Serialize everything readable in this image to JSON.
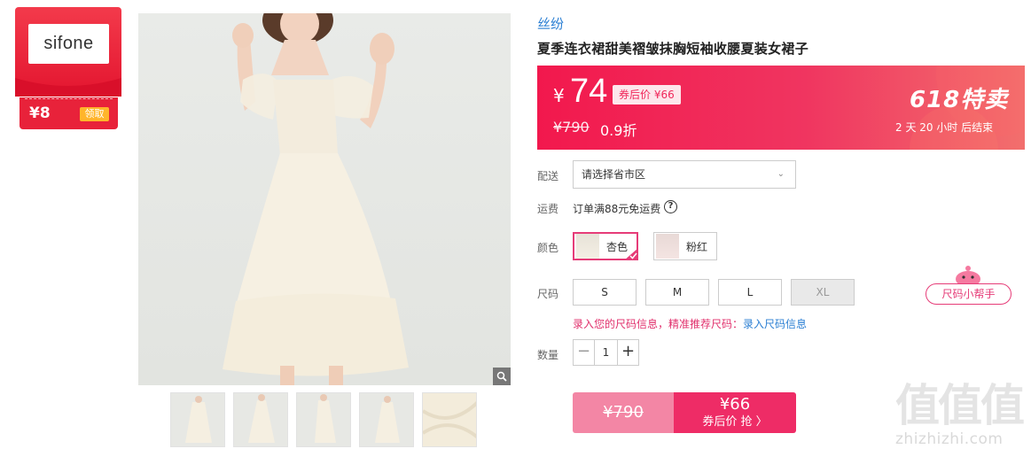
{
  "store": {
    "logo_text": "sifone",
    "coupon_amount": "¥8",
    "coupon_button": "领取"
  },
  "product": {
    "brand": "丝纷",
    "title": "夏季连衣裙甜美褶皱抹胸短袖收腰夏装女裙子"
  },
  "price_bar": {
    "currency": "¥",
    "price": "74",
    "after_coupon_label": "券后价 ¥66",
    "original_price": "¥790",
    "discount": "0.9折",
    "promo_title": "618特卖",
    "countdown": "2 天 20 小时 后结束"
  },
  "delivery": {
    "label": "配送",
    "placeholder": "请选择省市区"
  },
  "shipping": {
    "label": "运费",
    "text": "订单满88元免运费",
    "help": "?"
  },
  "colors": {
    "label": "颜色",
    "options": [
      {
        "name": "杏色",
        "selected": true
      },
      {
        "name": "粉红",
        "selected": false
      }
    ]
  },
  "sizes": {
    "label": "尺码",
    "options": [
      "S",
      "M",
      "L",
      "XL"
    ],
    "unavailable": [
      "XL"
    ],
    "helper": "尺码小帮手",
    "hint": "录入您的尺码信息，精准推荐尺码：",
    "hint_link": "录入尺码信息"
  },
  "quantity": {
    "label": "数量",
    "value": "1",
    "minus": "−",
    "plus": "+"
  },
  "buy": {
    "original_price": "¥790",
    "coupon_price": "¥66",
    "coupon_action": "券后价 抢 〉"
  },
  "watermark": {
    "big": "值值值",
    "small": "zhizhizhi.com"
  },
  "theme": {
    "accent": "#ee2c66",
    "link": "#2b7fd3",
    "store_red": "#e3152f"
  }
}
